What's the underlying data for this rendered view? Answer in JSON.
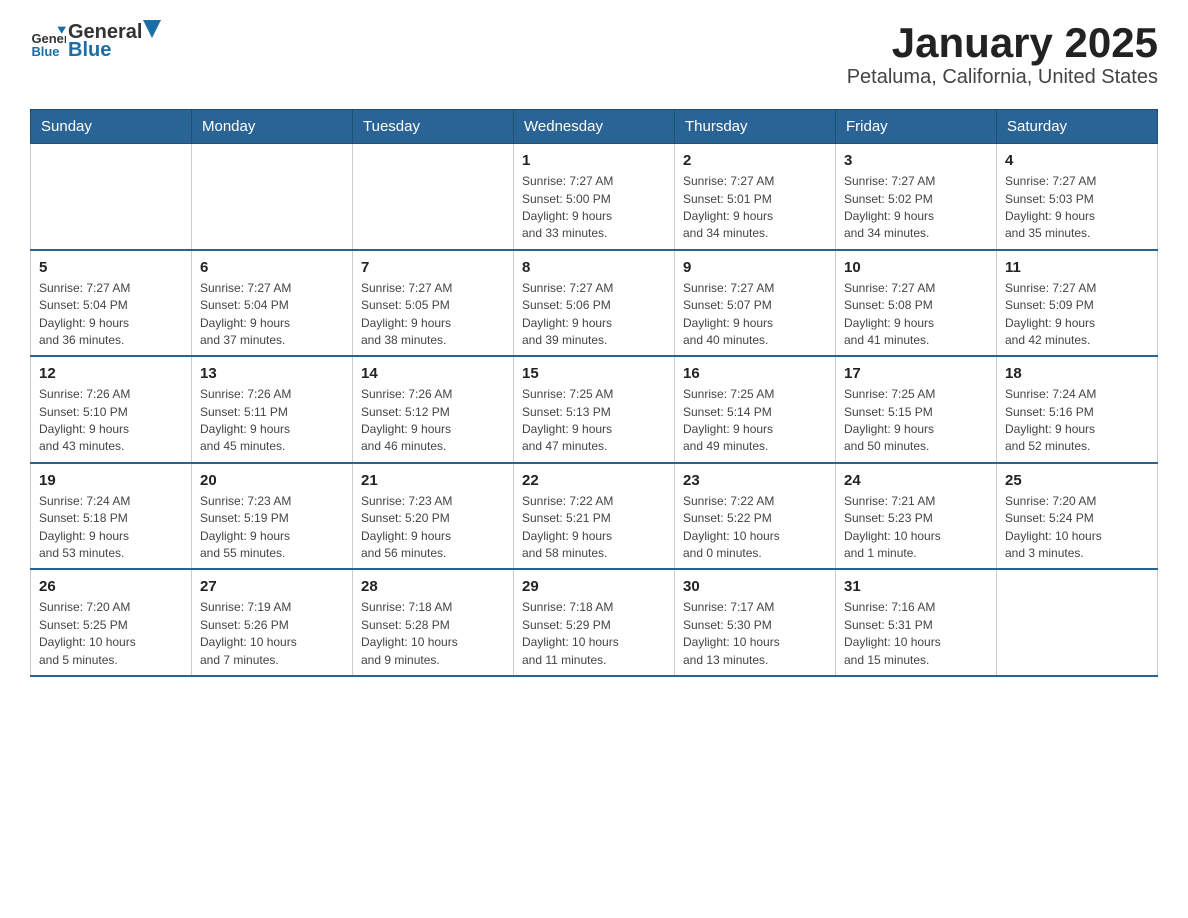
{
  "header": {
    "title": "January 2025",
    "subtitle": "Petaluma, California, United States",
    "logo_general": "General",
    "logo_blue": "Blue"
  },
  "columns": [
    "Sunday",
    "Monday",
    "Tuesday",
    "Wednesday",
    "Thursday",
    "Friday",
    "Saturday"
  ],
  "weeks": [
    [
      {
        "day": "",
        "info": ""
      },
      {
        "day": "",
        "info": ""
      },
      {
        "day": "",
        "info": ""
      },
      {
        "day": "1",
        "info": "Sunrise: 7:27 AM\nSunset: 5:00 PM\nDaylight: 9 hours\nand 33 minutes."
      },
      {
        "day": "2",
        "info": "Sunrise: 7:27 AM\nSunset: 5:01 PM\nDaylight: 9 hours\nand 34 minutes."
      },
      {
        "day": "3",
        "info": "Sunrise: 7:27 AM\nSunset: 5:02 PM\nDaylight: 9 hours\nand 34 minutes."
      },
      {
        "day": "4",
        "info": "Sunrise: 7:27 AM\nSunset: 5:03 PM\nDaylight: 9 hours\nand 35 minutes."
      }
    ],
    [
      {
        "day": "5",
        "info": "Sunrise: 7:27 AM\nSunset: 5:04 PM\nDaylight: 9 hours\nand 36 minutes."
      },
      {
        "day": "6",
        "info": "Sunrise: 7:27 AM\nSunset: 5:04 PM\nDaylight: 9 hours\nand 37 minutes."
      },
      {
        "day": "7",
        "info": "Sunrise: 7:27 AM\nSunset: 5:05 PM\nDaylight: 9 hours\nand 38 minutes."
      },
      {
        "day": "8",
        "info": "Sunrise: 7:27 AM\nSunset: 5:06 PM\nDaylight: 9 hours\nand 39 minutes."
      },
      {
        "day": "9",
        "info": "Sunrise: 7:27 AM\nSunset: 5:07 PM\nDaylight: 9 hours\nand 40 minutes."
      },
      {
        "day": "10",
        "info": "Sunrise: 7:27 AM\nSunset: 5:08 PM\nDaylight: 9 hours\nand 41 minutes."
      },
      {
        "day": "11",
        "info": "Sunrise: 7:27 AM\nSunset: 5:09 PM\nDaylight: 9 hours\nand 42 minutes."
      }
    ],
    [
      {
        "day": "12",
        "info": "Sunrise: 7:26 AM\nSunset: 5:10 PM\nDaylight: 9 hours\nand 43 minutes."
      },
      {
        "day": "13",
        "info": "Sunrise: 7:26 AM\nSunset: 5:11 PM\nDaylight: 9 hours\nand 45 minutes."
      },
      {
        "day": "14",
        "info": "Sunrise: 7:26 AM\nSunset: 5:12 PM\nDaylight: 9 hours\nand 46 minutes."
      },
      {
        "day": "15",
        "info": "Sunrise: 7:25 AM\nSunset: 5:13 PM\nDaylight: 9 hours\nand 47 minutes."
      },
      {
        "day": "16",
        "info": "Sunrise: 7:25 AM\nSunset: 5:14 PM\nDaylight: 9 hours\nand 49 minutes."
      },
      {
        "day": "17",
        "info": "Sunrise: 7:25 AM\nSunset: 5:15 PM\nDaylight: 9 hours\nand 50 minutes."
      },
      {
        "day": "18",
        "info": "Sunrise: 7:24 AM\nSunset: 5:16 PM\nDaylight: 9 hours\nand 52 minutes."
      }
    ],
    [
      {
        "day": "19",
        "info": "Sunrise: 7:24 AM\nSunset: 5:18 PM\nDaylight: 9 hours\nand 53 minutes."
      },
      {
        "day": "20",
        "info": "Sunrise: 7:23 AM\nSunset: 5:19 PM\nDaylight: 9 hours\nand 55 minutes."
      },
      {
        "day": "21",
        "info": "Sunrise: 7:23 AM\nSunset: 5:20 PM\nDaylight: 9 hours\nand 56 minutes."
      },
      {
        "day": "22",
        "info": "Sunrise: 7:22 AM\nSunset: 5:21 PM\nDaylight: 9 hours\nand 58 minutes."
      },
      {
        "day": "23",
        "info": "Sunrise: 7:22 AM\nSunset: 5:22 PM\nDaylight: 10 hours\nand 0 minutes."
      },
      {
        "day": "24",
        "info": "Sunrise: 7:21 AM\nSunset: 5:23 PM\nDaylight: 10 hours\nand 1 minute."
      },
      {
        "day": "25",
        "info": "Sunrise: 7:20 AM\nSunset: 5:24 PM\nDaylight: 10 hours\nand 3 minutes."
      }
    ],
    [
      {
        "day": "26",
        "info": "Sunrise: 7:20 AM\nSunset: 5:25 PM\nDaylight: 10 hours\nand 5 minutes."
      },
      {
        "day": "27",
        "info": "Sunrise: 7:19 AM\nSunset: 5:26 PM\nDaylight: 10 hours\nand 7 minutes."
      },
      {
        "day": "28",
        "info": "Sunrise: 7:18 AM\nSunset: 5:28 PM\nDaylight: 10 hours\nand 9 minutes."
      },
      {
        "day": "29",
        "info": "Sunrise: 7:18 AM\nSunset: 5:29 PM\nDaylight: 10 hours\nand 11 minutes."
      },
      {
        "day": "30",
        "info": "Sunrise: 7:17 AM\nSunset: 5:30 PM\nDaylight: 10 hours\nand 13 minutes."
      },
      {
        "day": "31",
        "info": "Sunrise: 7:16 AM\nSunset: 5:31 PM\nDaylight: 10 hours\nand 15 minutes."
      },
      {
        "day": "",
        "info": ""
      }
    ]
  ]
}
